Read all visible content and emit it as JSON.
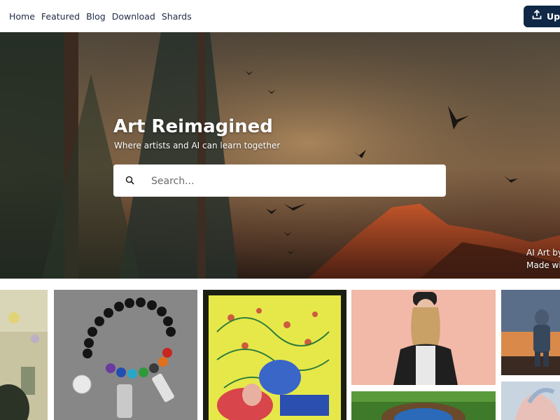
{
  "nav": {
    "items": [
      "Home",
      "Featured",
      "Blog",
      "Download",
      "Shards"
    ],
    "upload_label": "Upl"
  },
  "hero": {
    "title": "Art Reimagined",
    "subtitle": "Where artists and AI can learn together",
    "search_placeholder": "Search...",
    "credit_line1": "AI Art by",
    "credit_line2": "Made wi"
  },
  "gallery": {
    "tiles": [
      {
        "subject": "blurred street scene"
      },
      {
        "subject": "black bead chakra bracelet with charms"
      },
      {
        "subject": "colorful madhubani painting"
      },
      {
        "subject": "woman in leather jacket and cap"
      },
      {
        "subject": "armored figure at sunset"
      },
      {
        "subject": "eye in forest"
      },
      {
        "subject": "furry creature"
      }
    ]
  }
}
